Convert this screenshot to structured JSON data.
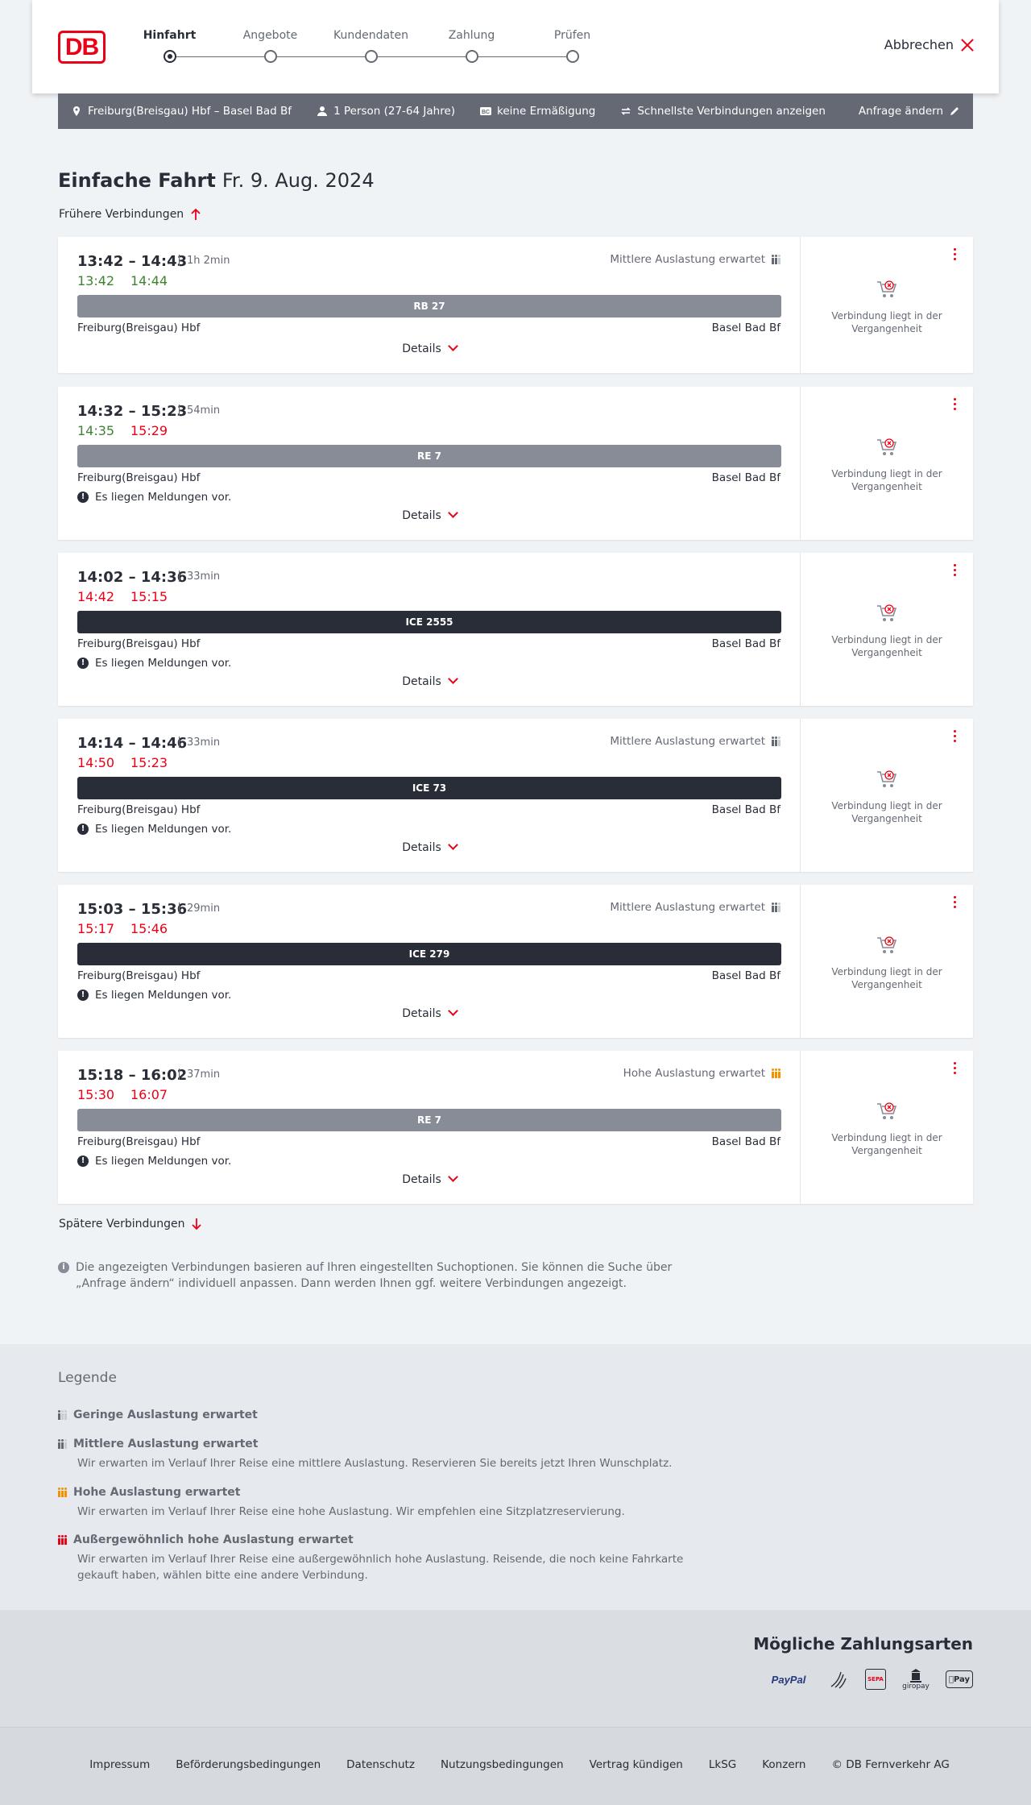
{
  "header": {
    "logo": "DB",
    "steps": [
      "Hinfahrt",
      "Angebote",
      "Kundendaten",
      "Zahlung",
      "Prüfen"
    ],
    "active_step": "Hinfahrt",
    "cancel_label": "Abbrechen"
  },
  "request": {
    "route": "Freiburg(Breisgau) Hbf – Basel Bad Bf",
    "passengers": "1 Person (27-64 Jahre)",
    "discount": "keine Ermäßigung",
    "option": "Schnellste Verbindungen anzeigen",
    "change_label": "Anfrage ändern"
  },
  "title": {
    "trip_type": "Einfache Fahrt",
    "date": "Fr. 9. Aug. 2024"
  },
  "earlier_label": "Frühere Verbindungen",
  "later_label": "Spätere Verbindungen",
  "connections": [
    {
      "times": "13:42 – 14:43",
      "duration": "1h 2min",
      "occupancy": "Mittlere Auslastung erwartet",
      "rt_dep": "13:42",
      "rt_arr": "14:44",
      "rt_dep_color": "green",
      "rt_arr_color": "green",
      "train": "RB 27",
      "train_kind": "regio",
      "from": "Freiburg(Breisgau) Hbf",
      "to": "Basel Bad Bf",
      "notice": "",
      "details": "Details",
      "side": "Verbindung liegt in der Vergangenheit"
    },
    {
      "times": "14:32 – 15:23",
      "duration": "54min",
      "occupancy": "",
      "rt_dep": "14:35",
      "rt_arr": "15:29",
      "rt_dep_color": "green",
      "rt_arr_color": "red",
      "train": "RE 7",
      "train_kind": "regio",
      "from": "Freiburg(Breisgau) Hbf",
      "to": "Basel Bad Bf",
      "notice": "Es liegen Meldungen vor.",
      "details": "Details",
      "side": "Verbindung liegt in der Vergangenheit"
    },
    {
      "times": "14:02 – 14:36",
      "duration": "33min",
      "occupancy": "",
      "rt_dep": "14:42",
      "rt_arr": "15:15",
      "rt_dep_color": "red",
      "rt_arr_color": "red",
      "train": "ICE 2555",
      "train_kind": "ice",
      "from": "Freiburg(Breisgau) Hbf",
      "to": "Basel Bad Bf",
      "notice": "Es liegen Meldungen vor.",
      "details": "Details",
      "side": "Verbindung liegt in der Vergangenheit"
    },
    {
      "times": "14:14 – 14:46",
      "duration": "33min",
      "occupancy": "Mittlere Auslastung erwartet",
      "rt_dep": "14:50",
      "rt_arr": "15:23",
      "rt_dep_color": "red",
      "rt_arr_color": "red",
      "train": "ICE 73",
      "train_kind": "ice",
      "from": "Freiburg(Breisgau) Hbf",
      "to": "Basel Bad Bf",
      "notice": "Es liegen Meldungen vor.",
      "details": "Details",
      "side": "Verbindung liegt in der Vergangenheit"
    },
    {
      "times": "15:03 – 15:36",
      "duration": "29min",
      "occupancy": "Mittlere Auslastung erwartet",
      "rt_dep": "15:17",
      "rt_arr": "15:46",
      "rt_dep_color": "red",
      "rt_arr_color": "red",
      "train": "ICE 279",
      "train_kind": "ice",
      "from": "Freiburg(Breisgau) Hbf",
      "to": "Basel Bad Bf",
      "notice": "Es liegen Meldungen vor.",
      "details": "Details",
      "side": "Verbindung liegt in der Vergangenheit"
    },
    {
      "times": "15:18 – 16:02",
      "duration": "37min",
      "occupancy": "Hohe Auslastung erwartet",
      "rt_dep": "15:30",
      "rt_arr": "16:07",
      "rt_dep_color": "red",
      "rt_arr_color": "red",
      "train": "RE 7",
      "train_kind": "regio",
      "from": "Freiburg(Breisgau) Hbf",
      "to": "Basel Bad Bf",
      "notice": "Es liegen Meldungen vor.",
      "details": "Details",
      "side": "Verbindung liegt in der Vergangenheit"
    }
  ],
  "info_text": "Die angezeigten Verbindungen basieren auf Ihren eingestellten Suchoptionen. Sie können die Suche über „Anfrage ändern“ individuell anpassen. Dann werden Ihnen ggf. weitere Verbindungen angezeigt.",
  "legend": {
    "title": "Legende",
    "items": [
      {
        "title": "Geringe Auslastung erwartet",
        "text": ""
      },
      {
        "title": "Mittlere Auslastung erwartet",
        "text": "Wir erwarten im Verlauf Ihrer Reise eine mittlere Auslastung. Reservieren Sie bereits jetzt Ihren Wunschplatz."
      },
      {
        "title": "Hohe Auslastung erwartet",
        "text": "Wir erwarten im Verlauf Ihrer Reise eine hohe Auslastung. Wir empfehlen eine Sitzplatzreservierung."
      },
      {
        "title": "Außergewöhnlich hohe Auslastung erwartet",
        "text": "Wir erwarten im Verlauf Ihrer Reise eine außergewöhnlich hohe Auslastung. Reisende, die noch keine Fahrkarte gekauft haben, wählen bitte eine andere Verbindung."
      }
    ]
  },
  "payment": {
    "title": "Mögliche Zahlungsarten",
    "methods": [
      "PayPal",
      "SEPA",
      "giropay",
      "Pay"
    ]
  },
  "footer": {
    "links": [
      "Impressum",
      "Beförderungsbedingungen",
      "Datenschutz",
      "Nutzungsbedingungen",
      "Vertrag kündigen",
      "LkSG",
      "Konzern",
      "© DB Fernverkehr AG"
    ]
  },
  "colors": {
    "brand_red": "#ec0016",
    "ontime_green": "#408335",
    "regio_bar": "#878c96",
    "ice_bar": "#282d37",
    "high_load": "#f39200"
  }
}
